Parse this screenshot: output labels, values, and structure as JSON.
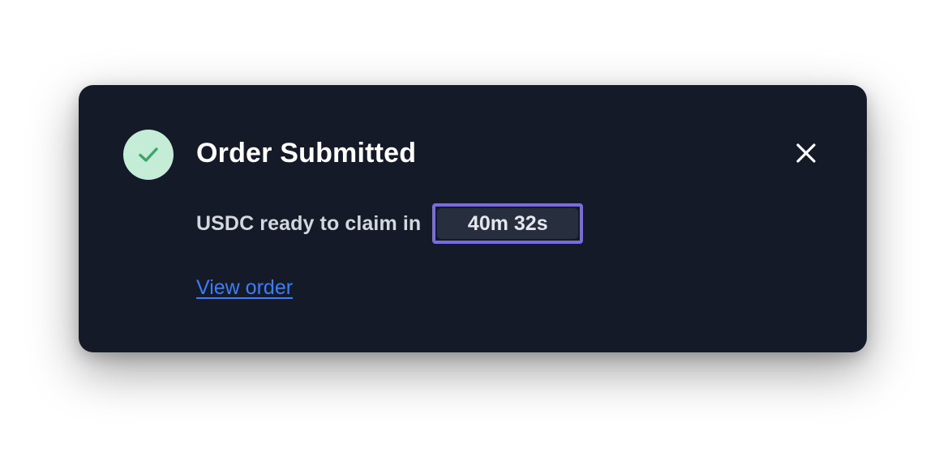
{
  "toast": {
    "icon": "check-icon",
    "title": "Order Submitted",
    "close_icon": "close-icon",
    "message": "USDC ready to claim in",
    "countdown": "40m 32s",
    "link_label": "View order"
  },
  "colors": {
    "background": "#141a27",
    "success_circle": "#c4ecd6",
    "success_check": "#3fa36b",
    "badge_border": "#7a6cdc",
    "link": "#3d7ef7"
  }
}
